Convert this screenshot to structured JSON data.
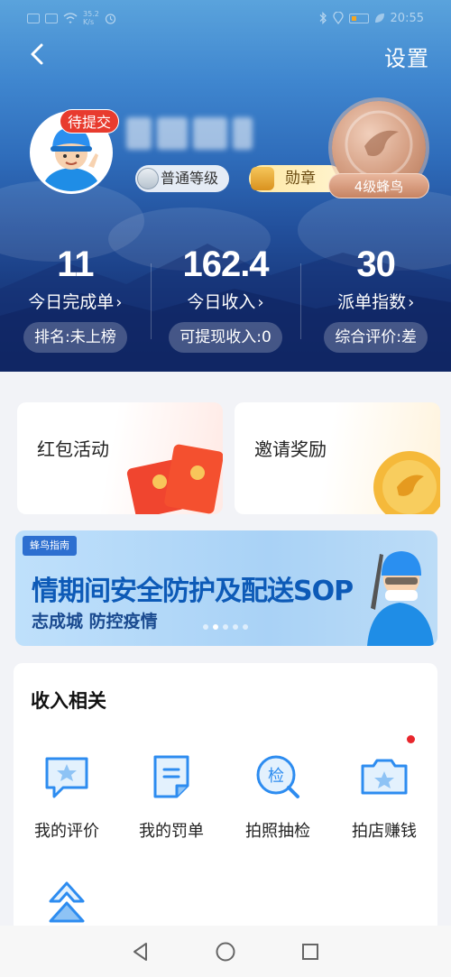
{
  "status_bar": {
    "network_speed": "35.2\nK/s",
    "time": "20:55"
  },
  "header": {
    "settings_label": "设置",
    "pending_badge": "待提交",
    "level_label": "普通等级",
    "medal_label": "勋章",
    "rank_label": "4级蜂鸟"
  },
  "stats": [
    {
      "value": "11",
      "label": "今日完成单",
      "pill": "排名:未上榜"
    },
    {
      "value": "162.4",
      "label": "今日收入",
      "pill": "可提现收入:0"
    },
    {
      "value": "30",
      "label": "派单指数",
      "pill": "综合评价:差"
    }
  ],
  "cards": {
    "hongbao_title": "红包活动",
    "invite_title": "邀请奖励"
  },
  "banner": {
    "tag": "蜂鸟指南",
    "headline": "情期间安全防护及配送SOP",
    "subline": "志成城 防控疫情",
    "page_count": 5,
    "active_index": 1
  },
  "income_section": {
    "title": "收入相关",
    "items": [
      {
        "label": "我的评价",
        "icon": "star-chat-icon"
      },
      {
        "label": "我的罚单",
        "icon": "ticket-icon"
      },
      {
        "label": "拍照抽检",
        "icon": "inspect-icon",
        "icon_text": "检"
      },
      {
        "label": "拍店赚钱",
        "icon": "camera-icon"
      },
      {
        "label": "",
        "icon": "level-up-icon"
      }
    ]
  },
  "colors": {
    "accent": "#2d8cf0",
    "badge_red": "#e83b2e"
  }
}
